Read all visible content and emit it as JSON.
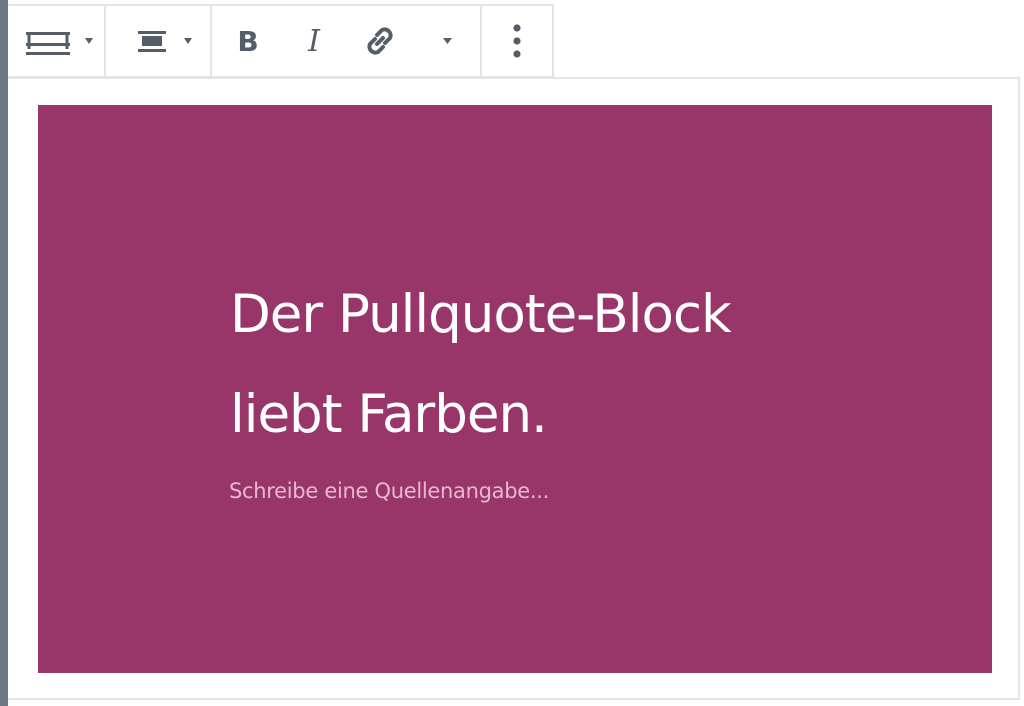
{
  "toolbar": {
    "buttons": [
      {
        "icon": "block-style-icon",
        "has_dropdown": true
      },
      {
        "icon": "align-center-icon",
        "has_dropdown": true
      },
      {
        "icon": "bold-icon"
      },
      {
        "icon": "italic-icon"
      },
      {
        "icon": "link-icon"
      },
      {
        "icon": "more-formatting-chevron-icon"
      },
      {
        "icon": "more-options-icon"
      }
    ]
  },
  "pullquote": {
    "background_color": "#983669",
    "text_color": "#ffffff",
    "quote_line1": "Der Pullquote-Block",
    "quote_line2": "liebt Farben.",
    "citation_placeholder": "Schreibe eine Quellenangabe..."
  },
  "colors": {
    "rail": "#6c7781",
    "border": "#e2e4e7",
    "icon": "#555d66"
  }
}
